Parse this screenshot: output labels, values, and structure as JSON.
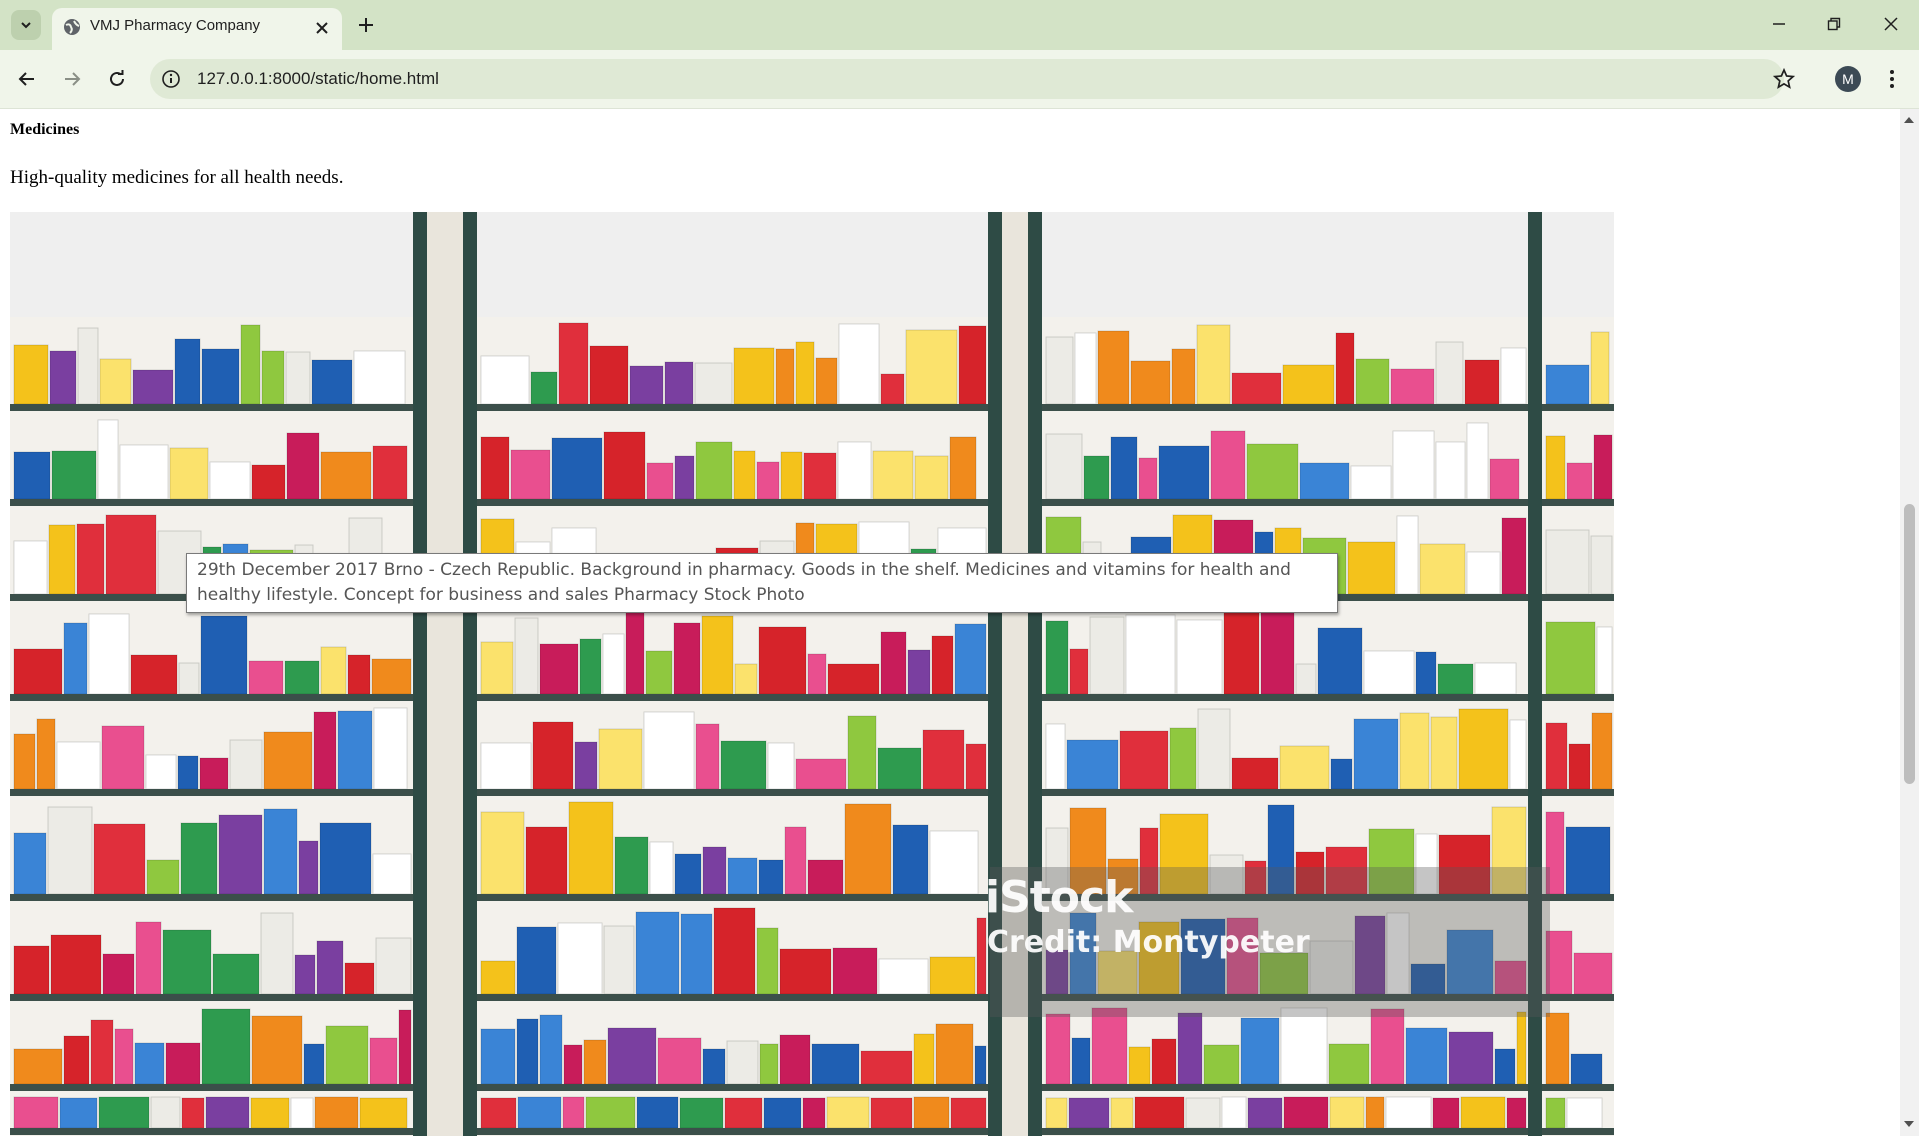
{
  "browser": {
    "tab_title": "VMJ Pharmacy Company",
    "url": "127.0.0.1:8000/static/home.html",
    "profile_initial": "M"
  },
  "page": {
    "section_heading": "Medicines",
    "description": "High-quality medicines for all health needs.",
    "image": {
      "tooltip": "29th December 2017 Brno - Czech Republic. Background in pharmacy. Goods in the shelf. Medicines and vitamins for health and healthy lifestyle. Concept for business and sales Pharmacy Stock Photo",
      "watermark_logo": "iStock",
      "watermark_credit": "Credit: Montypeter"
    }
  },
  "colors": {
    "tabstrip": "#d3e3c6",
    "toolbar": "#f0f5ea",
    "omnibox": "#dfe9d5"
  }
}
